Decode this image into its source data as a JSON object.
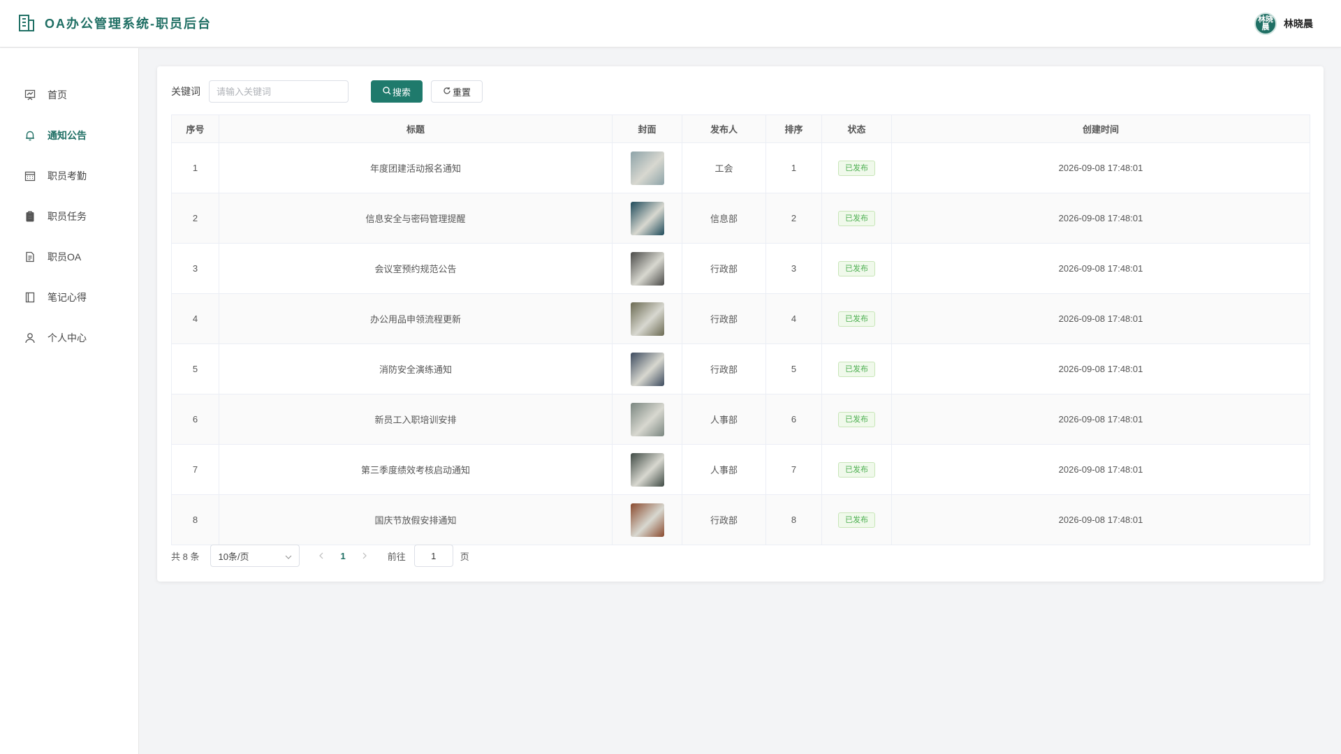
{
  "header": {
    "title": "OA办公管理系统-职员后台",
    "user": {
      "avatar_text": "林晓晨",
      "name": "林晓晨"
    }
  },
  "sidebar": {
    "items": [
      {
        "label": "首页",
        "icon": "chart-board-icon",
        "active": false
      },
      {
        "label": "通知公告",
        "icon": "bell-icon",
        "active": true
      },
      {
        "label": "职员考勤",
        "icon": "calendar-icon",
        "active": false
      },
      {
        "label": "职员任务",
        "icon": "clipboard-icon",
        "active": false
      },
      {
        "label": "职员OA",
        "icon": "document-icon",
        "active": false
      },
      {
        "label": "笔记心得",
        "icon": "notebook-icon",
        "active": false
      },
      {
        "label": "个人中心",
        "icon": "user-icon",
        "active": false
      }
    ]
  },
  "search": {
    "label": "关键词",
    "placeholder": "请输入关键词",
    "value": "",
    "search_button": "搜索",
    "reset_button": "重置"
  },
  "table": {
    "columns": [
      "序号",
      "标题",
      "封面",
      "发布人",
      "排序",
      "状态",
      "创建时间"
    ],
    "rows": [
      {
        "index": "1",
        "title": "年度团建活动报名通知",
        "cover_color": "#8da3a8",
        "publisher": "工会",
        "order": "1",
        "status": "已发布",
        "created": "2026-09-08 17:48:01"
      },
      {
        "index": "2",
        "title": "信息安全与密码管理提醒",
        "cover_color": "#1e4a5a",
        "publisher": "信息部",
        "order": "2",
        "status": "已发布",
        "created": "2026-09-08 17:48:01"
      },
      {
        "index": "3",
        "title": "会议室预约规范公告",
        "cover_color": "#4a4a48",
        "publisher": "行政部",
        "order": "3",
        "status": "已发布",
        "created": "2026-09-08 17:48:01"
      },
      {
        "index": "4",
        "title": "办公用品申领流程更新",
        "cover_color": "#6b6a52",
        "publisher": "行政部",
        "order": "4",
        "status": "已发布",
        "created": "2026-09-08 17:48:01"
      },
      {
        "index": "5",
        "title": "消防安全演练通知",
        "cover_color": "#3c4a5e",
        "publisher": "行政部",
        "order": "5",
        "status": "已发布",
        "created": "2026-09-08 17:48:01"
      },
      {
        "index": "6",
        "title": "新员工入职培训安排",
        "cover_color": "#7a8680",
        "publisher": "人事部",
        "order": "6",
        "status": "已发布",
        "created": "2026-09-08 17:48:01"
      },
      {
        "index": "7",
        "title": "第三季度绩效考核启动通知",
        "cover_color": "#3f4a44",
        "publisher": "人事部",
        "order": "7",
        "status": "已发布",
        "created": "2026-09-08 17:48:01"
      },
      {
        "index": "8",
        "title": "国庆节放假安排通知",
        "cover_color": "#8a4a2e",
        "publisher": "行政部",
        "order": "8",
        "status": "已发布",
        "created": "2026-09-08 17:48:01"
      }
    ]
  },
  "pagination": {
    "total": "共 8 条",
    "page_size": "10条/页",
    "current_page": "1",
    "goto_label": "前往",
    "goto_value": "1",
    "page_suffix": "页"
  },
  "colors": {
    "accent": "#1f6f64",
    "primary_button": "#1f7a6c",
    "status_tag": "#4caf50"
  }
}
